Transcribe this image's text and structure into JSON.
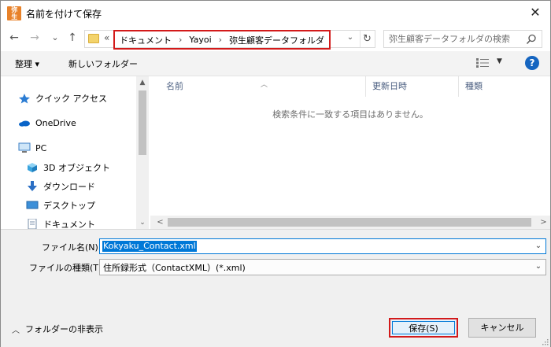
{
  "window": {
    "title": "名前を付けて保存",
    "app_icon_text": [
      "弥",
      "生"
    ],
    "close_glyph": "✕"
  },
  "navigation": {
    "back_glyph": "←",
    "forward_glyph": "→",
    "recent_glyph": "⌄",
    "up_glyph": "↑"
  },
  "address": {
    "overflow": "«",
    "path": [
      "ドキュメント",
      "Yayoi",
      "弥生顧客データフォルダ"
    ],
    "separator": "›",
    "dropdown_glyph": "⌄",
    "refresh_glyph": "↻"
  },
  "search": {
    "placeholder": "弥生顧客データフォルダの検索"
  },
  "toolbar": {
    "organize_label": "整理 ▾",
    "new_folder_label": "新しいフォルダー",
    "view_dropdown_glyph": "▼",
    "help_label": "?"
  },
  "nav_pane": {
    "items": [
      {
        "label": "クイック アクセス",
        "icon": "star-icon"
      },
      {
        "label": "OneDrive",
        "icon": "cloud-icon"
      },
      {
        "label": "PC",
        "icon": "computer-icon"
      },
      {
        "label": "3D オブジェクト",
        "icon": "cube-icon"
      },
      {
        "label": "ダウンロード",
        "icon": "download-icon"
      },
      {
        "label": "デスクトップ",
        "icon": "desktop-icon"
      },
      {
        "label": "ドキュメント",
        "icon": "document-icon"
      }
    ],
    "scroll_up_glyph": "▲",
    "scroll_down_glyph": "⌄"
  },
  "file_list": {
    "columns": [
      "名前",
      "更新日時",
      "種類"
    ],
    "sort_glyph": "︿",
    "empty_message": "検索条件に一致する項目はありません。",
    "scroll_left_glyph": "<",
    "scroll_right_glyph": ">"
  },
  "form": {
    "filename_label": "ファイル名(N):",
    "filename_value": "Kokyaku_Contact.xml",
    "filetype_label": "ファイルの種類(T):",
    "filetype_value": "住所録形式（ContactXML）(*.xml)",
    "dropdown_glyph": "⌄"
  },
  "footer": {
    "hide_folders_label": "フォルダーの非表示",
    "hide_folders_glyph": "︿",
    "save_label": "保存(S)",
    "cancel_label": "キャンセル"
  },
  "colors": {
    "highlight_red": "#d31a1a",
    "selection_blue": "#0078d7",
    "help_blue": "#1565c0"
  }
}
